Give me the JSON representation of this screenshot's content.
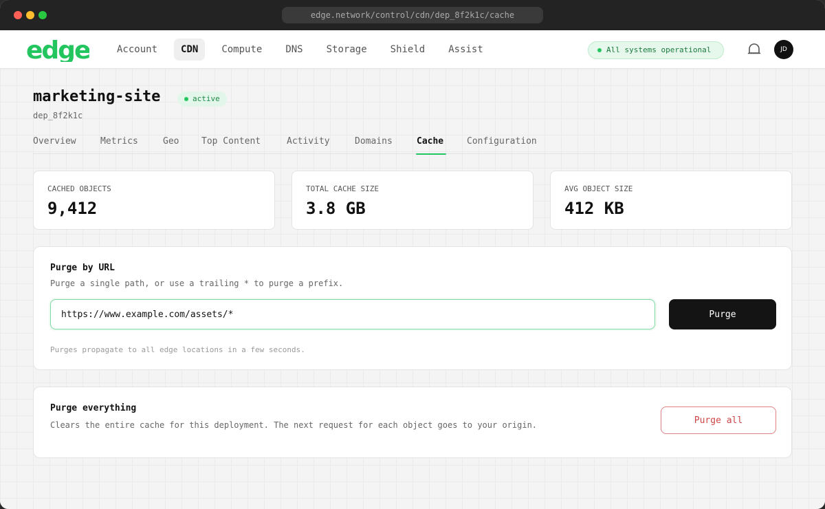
{
  "browser": {
    "url": "edge.network/control/cdn/dep_8f2k1c/cache"
  },
  "header": {
    "logo_text": "edge",
    "brand_color": "#22c55e",
    "nav": [
      {
        "label": "Account",
        "active": false
      },
      {
        "label": "CDN",
        "active": true
      },
      {
        "label": "Compute",
        "active": false
      },
      {
        "label": "DNS",
        "active": false
      },
      {
        "label": "Storage",
        "active": false
      },
      {
        "label": "Shield",
        "active": false
      },
      {
        "label": "Assist",
        "active": false
      }
    ],
    "status_text": "All systems operational",
    "notifications_icon": "bell-icon",
    "avatar_initials": "JD"
  },
  "project": {
    "name": "marketing-site",
    "status": "active",
    "id": "dep_8f2k1c"
  },
  "tabs": [
    {
      "label": "Overview",
      "active": false
    },
    {
      "label": "Metrics",
      "active": false
    },
    {
      "label": "Geo",
      "active": false
    },
    {
      "label": "Top Content",
      "active": false
    },
    {
      "label": "Activity",
      "active": false
    },
    {
      "label": "Domains",
      "active": false
    },
    {
      "label": "Cache",
      "active": true
    },
    {
      "label": "Configuration",
      "active": false
    }
  ],
  "stats": [
    {
      "label": "CACHED OBJECTS",
      "value": "9,412"
    },
    {
      "label": "TOTAL CACHE SIZE",
      "value": "3.8 GB"
    },
    {
      "label": "AVG OBJECT SIZE",
      "value": "412 KB"
    }
  ],
  "purge_url": {
    "title": "Purge by URL",
    "description": "Purge a single path, or use a trailing * to purge a prefix.",
    "input_value": "https://www.example.com/assets/*",
    "button_label": "Purge",
    "hint": "Purges propagate to all edge locations in a few seconds."
  },
  "purge_all": {
    "title": "Purge everything",
    "description": "Clears the entire cache for this deployment. The next request for each object goes to your origin.",
    "button_label": "Purge all",
    "danger_color": "#d04646"
  }
}
